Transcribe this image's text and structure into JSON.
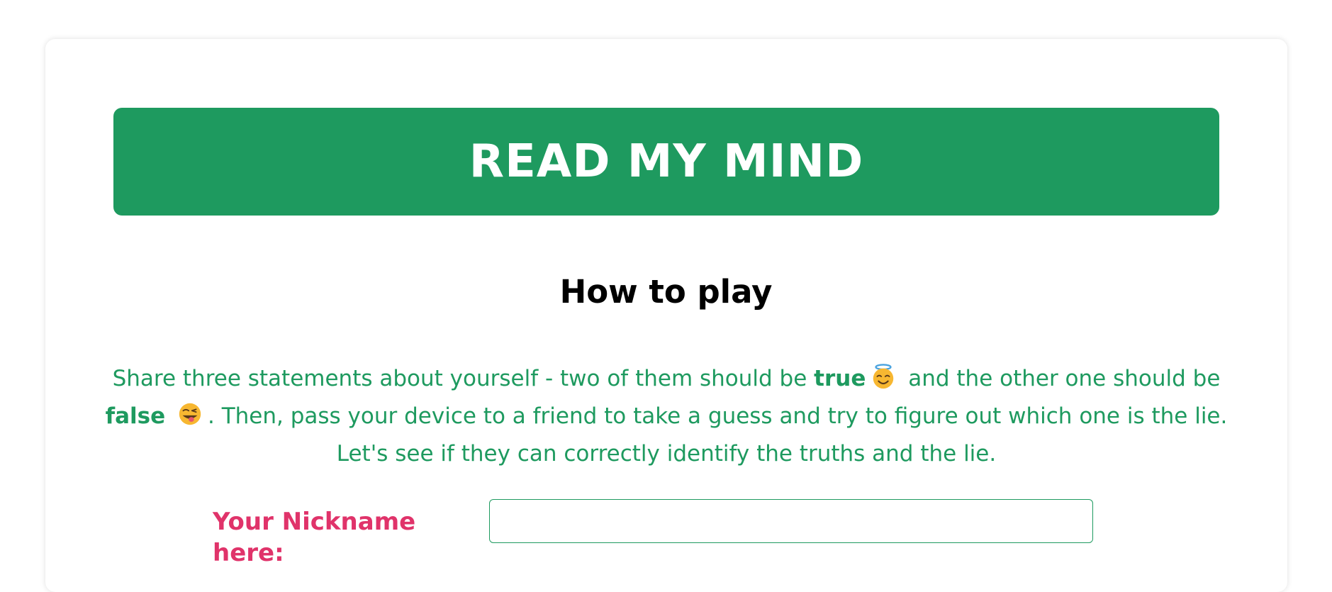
{
  "header": {
    "title": "READ MY MIND"
  },
  "instructions": {
    "heading": "How to play",
    "text_part1": "Share three statements about yourself - two of them should be ",
    "true_word": "true",
    "text_part2": " and the other one should be ",
    "false_word": "false",
    "text_part3": ". Then, pass your device to a friend to take a guess and try to figure out which one is the lie. Let's see if they can correctly identify the truths and the lie.",
    "true_emoji": "innocent-halo-face-icon",
    "false_emoji": "winking-tongue-face-icon"
  },
  "nickname": {
    "label": "Your Nickname here:",
    "value": "",
    "placeholder": ""
  },
  "colors": {
    "accent_green": "#1e9a5f",
    "label_pink": "#e0336a"
  }
}
